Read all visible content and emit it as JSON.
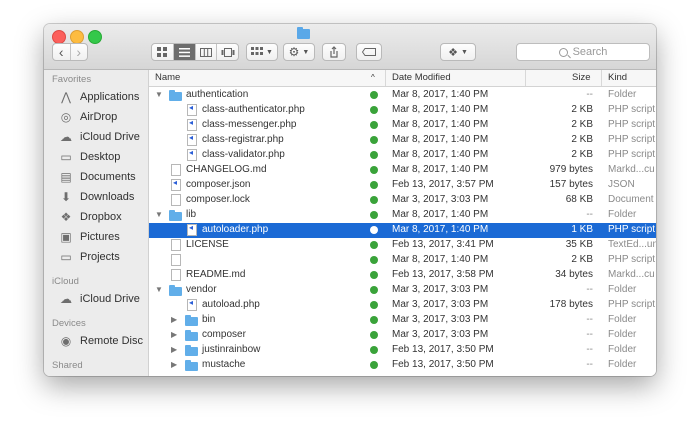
{
  "toolbar": {
    "search_placeholder": "Search",
    "nav_back": "‹",
    "nav_forward": "›"
  },
  "columns": {
    "name": "Name",
    "sort_indicator": "^",
    "date": "Date Modified",
    "size": "Size",
    "kind": "Kind"
  },
  "sidebar": {
    "favorites_title": "Favorites",
    "favorites": [
      {
        "label": "Applications",
        "icon": "applications-icon"
      },
      {
        "label": "AirDrop",
        "icon": "airdrop-icon"
      },
      {
        "label": "iCloud Drive",
        "icon": "cloud-icon"
      },
      {
        "label": "Desktop",
        "icon": "desktop-icon"
      },
      {
        "label": "Documents",
        "icon": "documents-icon"
      },
      {
        "label": "Downloads",
        "icon": "downloads-icon"
      },
      {
        "label": "Dropbox",
        "icon": "dropbox-icon"
      },
      {
        "label": "Pictures",
        "icon": "pictures-icon"
      },
      {
        "label": "Projects",
        "icon": "folder-icon"
      }
    ],
    "icloud_title": "iCloud",
    "icloud": [
      {
        "label": "iCloud Drive",
        "icon": "cloud-icon"
      }
    ],
    "devices_title": "Devices",
    "devices": [
      {
        "label": "Remote Disc",
        "icon": "disc-icon"
      }
    ],
    "shared_title": "Shared"
  },
  "files": [
    {
      "name": "authentication",
      "date": "Mar 8, 2017, 1:40 PM",
      "size": "--",
      "kind": "Folder",
      "type": "folder",
      "indent": 0,
      "disclosure": "open",
      "synced": true
    },
    {
      "name": "class-authenticator.php",
      "date": "Mar 8, 2017, 1:40 PM",
      "size": "2 KB",
      "kind": "PHP script",
      "type": "php",
      "indent": 1,
      "disclosure": "none",
      "synced": true
    },
    {
      "name": "class-messenger.php",
      "date": "Mar 8, 2017, 1:40 PM",
      "size": "2 KB",
      "kind": "PHP script",
      "type": "php",
      "indent": 1,
      "disclosure": "none",
      "synced": true
    },
    {
      "name": "class-registrar.php",
      "date": "Mar 8, 2017, 1:40 PM",
      "size": "2 KB",
      "kind": "PHP script",
      "type": "php",
      "indent": 1,
      "disclosure": "none",
      "synced": true
    },
    {
      "name": "class-validator.php",
      "date": "Mar 8, 2017, 1:40 PM",
      "size": "2 KB",
      "kind": "PHP script",
      "type": "php",
      "indent": 1,
      "disclosure": "none",
      "synced": true
    },
    {
      "name": "CHANGELOG.md",
      "date": "Mar 8, 2017, 1:40 PM",
      "size": "979 bytes",
      "kind": "Markd...cu",
      "type": "doc",
      "indent": 0,
      "disclosure": "none",
      "synced": true
    },
    {
      "name": "composer.json",
      "date": "Feb 13, 2017, 3:57 PM",
      "size": "157 bytes",
      "kind": "JSON",
      "type": "json",
      "indent": 0,
      "disclosure": "none",
      "synced": true
    },
    {
      "name": "composer.lock",
      "date": "Mar 3, 2017, 3:03 PM",
      "size": "68 KB",
      "kind": "Document",
      "type": "doc",
      "indent": 0,
      "disclosure": "none",
      "synced": true
    },
    {
      "name": "lib",
      "date": "Mar 8, 2017, 1:40 PM",
      "size": "--",
      "kind": "Folder",
      "type": "folder",
      "indent": 0,
      "disclosure": "open",
      "synced": true
    },
    {
      "name": "autoloader.php",
      "date": "Mar 8, 2017, 1:40 PM",
      "size": "1 KB",
      "kind": "PHP script",
      "type": "php",
      "indent": 1,
      "disclosure": "none",
      "synced": true,
      "selected": true
    },
    {
      "name": "LICENSE",
      "date": "Feb 13, 2017, 3:41 PM",
      "size": "35 KB",
      "kind": "TextEd...ument",
      "type": "doc",
      "indent": 0,
      "disclosure": "none",
      "synced": true
    },
    {
      "name": "",
      "date": "Mar 8, 2017, 1:40 PM",
      "size": "2 KB",
      "kind": "PHP script",
      "type": "doc",
      "indent": 0,
      "disclosure": "none",
      "synced": true
    },
    {
      "name": "README.md",
      "date": "Feb 13, 2017, 3:58 PM",
      "size": "34 bytes",
      "kind": "Markd...cu",
      "type": "doc",
      "indent": 0,
      "disclosure": "none",
      "synced": true
    },
    {
      "name": "vendor",
      "date": "Mar 3, 2017, 3:03 PM",
      "size": "--",
      "kind": "Folder",
      "type": "folder",
      "indent": 0,
      "disclosure": "open",
      "synced": true
    },
    {
      "name": "autoload.php",
      "date": "Mar 3, 2017, 3:03 PM",
      "size": "178 bytes",
      "kind": "PHP script",
      "type": "php",
      "indent": 1,
      "disclosure": "none",
      "synced": true
    },
    {
      "name": "bin",
      "date": "Mar 3, 2017, 3:03 PM",
      "size": "--",
      "kind": "Folder",
      "type": "folder",
      "indent": 1,
      "disclosure": "closed",
      "synced": true
    },
    {
      "name": "composer",
      "date": "Mar 3, 2017, 3:03 PM",
      "size": "--",
      "kind": "Folder",
      "type": "folder",
      "indent": 1,
      "disclosure": "closed",
      "synced": true
    },
    {
      "name": "justinrainbow",
      "date": "Feb 13, 2017, 3:50 PM",
      "size": "--",
      "kind": "Folder",
      "type": "folder",
      "indent": 1,
      "disclosure": "closed",
      "synced": true
    },
    {
      "name": "mustache",
      "date": "Feb 13, 2017, 3:50 PM",
      "size": "--",
      "kind": "Folder",
      "type": "folder",
      "indent": 1,
      "disclosure": "closed",
      "synced": true
    }
  ],
  "colors": {
    "selection": "#1b6ad5",
    "folder": "#61aee9",
    "sync_ok": "#3aa33a"
  }
}
